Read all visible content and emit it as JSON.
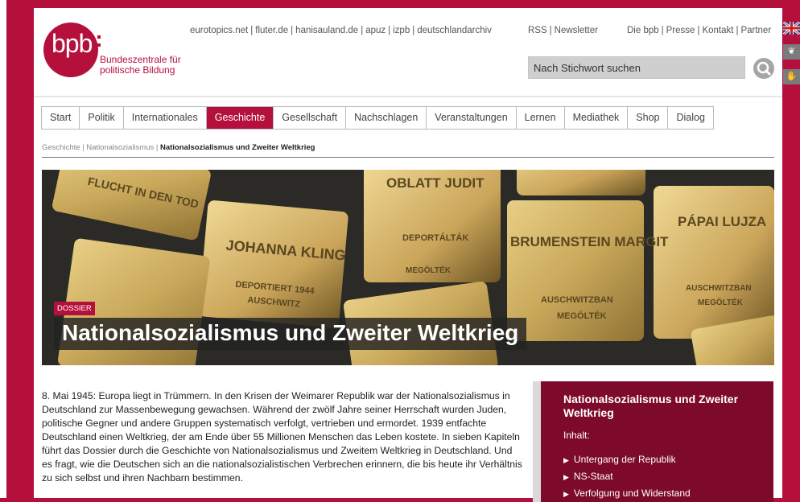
{
  "logo": {
    "text": "bpb",
    "sub_line1": "Bundeszentrale für",
    "sub_line2": "politische Bildung"
  },
  "partner_links": [
    "eurotopics.net",
    "fluter.de",
    "hanisauland.de",
    "apuz",
    "izpb",
    "deutschlandarchiv"
  ],
  "service_links": [
    "RSS",
    "Newsletter"
  ],
  "meta_links": [
    "Die bpb",
    "Presse",
    "Kontakt",
    "Partner"
  ],
  "search": {
    "placeholder": "Nach Stichwort suchen"
  },
  "nav": {
    "items": [
      "Start",
      "Politik",
      "Internationales",
      "Geschichte",
      "Gesellschaft",
      "Nachschlagen",
      "Veranstaltungen",
      "Lernen",
      "Mediathek",
      "Shop",
      "Dialog"
    ],
    "active": "Geschichte"
  },
  "breadcrumb": {
    "level1": "Geschichte",
    "level2": "Nationalsozialismus",
    "current": "Nationalsozialismus und Zweiter Weltkrieg"
  },
  "hero": {
    "tag": "DOSSIER",
    "title": "Nationalsozialismus und Zweiter Weltkrieg",
    "stone_texts": [
      "FLUCHT IN DEN TOD",
      "JOHANNA KLING",
      "DEPORTIERT 1944",
      "AUSCHWITZ",
      "OBLATT JUDIT",
      "DEPORTÁLTÁK",
      "BRUMENSTEIN MARGIT",
      "PÁPAI LUJZA",
      "AUSCHWITZBAN",
      "MEGÖLTÉK"
    ]
  },
  "intro": {
    "text": "8. Mai 1945: Europa liegt in Trümmern. In den Krisen der Weimarer Republik war der Nationalsozialismus in Deutschland zur Massenbewegung gewachsen. Während der zwölf Jahre seiner Herrschaft wurden Juden, politische Gegner und andere Gruppen systematisch verfolgt, vertrieben und ermordet. 1939 entfachte Deutschland einen Weltkrieg, der am Ende über 55 Millionen Menschen das Leben kostete. In sieben Kapiteln führt das Dossier durch die Geschichte von Nationalsozialismus und Zweitem Weltkrieg in Deutschland. Und es fragt, wie die Deutschen sich an die nationalsozialistischen Verbrechen erinnern, die bis heute ihr Verhältnis zu sich selbst und ihren Nachbarn bestimmen."
  },
  "sidebar": {
    "title": "Nationalsozialismus und Zweiter Weltkrieg",
    "subtitle": "Inhalt:",
    "items": [
      "Untergang der Republik",
      "NS-Staat",
      "Verfolgung und Widerstand"
    ]
  },
  "colors": {
    "brand": "#b5103c",
    "sidebar_bg": "#7d0a2a",
    "nav_active": "#b5103c"
  }
}
